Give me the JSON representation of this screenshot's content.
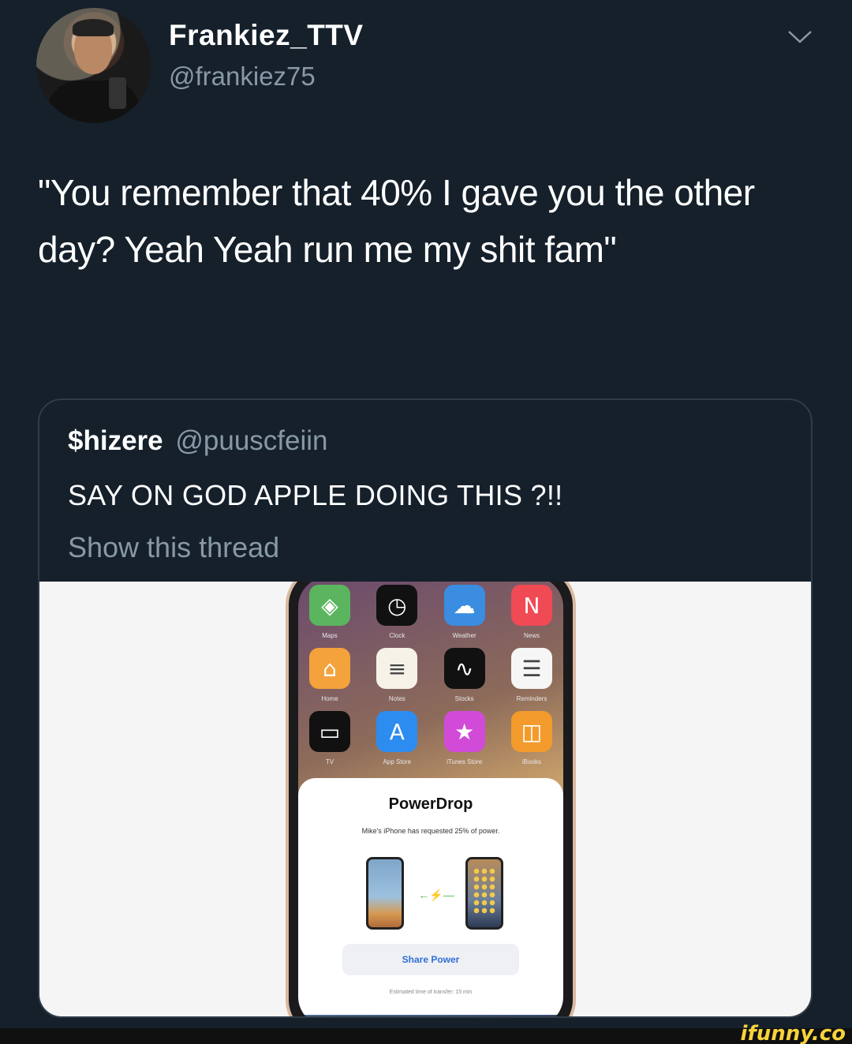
{
  "tweet": {
    "display_name": "Frankiez_TTV",
    "handle": "@frankiez75",
    "text": "\"You remember that 40% I gave you the other day? Yeah Yeah run me my shit fam\""
  },
  "quoted_tweet": {
    "name": "$hizere",
    "handle": "@puuscfeiin",
    "text": "SAY ON GOD APPLE DOING THIS ?!!",
    "show_thread": "Show this thread"
  },
  "media": {
    "apps_row1": [
      {
        "icon": "maps-icon",
        "label": "Maps",
        "color": "#5ab55e"
      },
      {
        "icon": "clock-icon",
        "label": "Clock",
        "color": "#111111"
      },
      {
        "icon": "weather-icon",
        "label": "Weather",
        "color": "#3a8de0"
      },
      {
        "icon": "news-icon",
        "label": "News",
        "color": "#f04a55"
      }
    ],
    "apps_row2": [
      {
        "icon": "home-icon",
        "label": "Home",
        "color": "#f4a23c"
      },
      {
        "icon": "notes-icon",
        "label": "Notes",
        "color": "#f6f2e8"
      },
      {
        "icon": "stocks-icon",
        "label": "Stocks",
        "color": "#111111"
      },
      {
        "icon": "reminders-icon",
        "label": "Reminders",
        "color": "#f6f6f6"
      }
    ],
    "apps_row3": [
      {
        "icon": "tv-icon",
        "label": "TV",
        "color": "#111111"
      },
      {
        "icon": "app-store-icon",
        "label": "App Store",
        "color": "#2d8cf0"
      },
      {
        "icon": "itunes-store-icon",
        "label": "iTunes Store",
        "color": "#d24bd8"
      },
      {
        "icon": "ibooks-icon",
        "label": "iBooks",
        "color": "#f39a2c"
      }
    ],
    "sheet_title": "PowerDrop",
    "sheet_subtitle": "Mike's iPhone has requested 25% of power.",
    "share_button": "Share Power",
    "eta": "Estimated time of transfer: 15 min"
  },
  "watermark": "ifunny.co"
}
